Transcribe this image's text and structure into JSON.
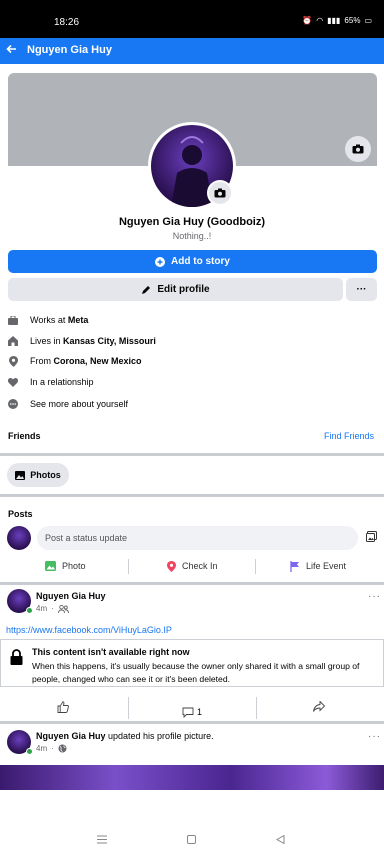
{
  "status_bar": {
    "time": "18:26",
    "battery": "65%"
  },
  "nav": {
    "title": "Nguyen Gia Huy"
  },
  "profile": {
    "name": "Nguyen Gia Huy (Goodboiz)",
    "bio": "Nothing..!",
    "add_story_label": "Add to story",
    "edit_profile_label": "Edit profile",
    "more_label": "···"
  },
  "about": {
    "work_prefix": "Works at ",
    "work_value": "Meta",
    "live_prefix": "Lives in ",
    "live_value": "Kansas City, Missouri",
    "from_prefix": "From ",
    "from_value": "Corona, New Mexico",
    "relationship": "In a relationship",
    "see_more": "See more about yourself"
  },
  "friends": {
    "label": "Friends",
    "find_label": "Find Friends"
  },
  "photos": {
    "label": "Photos"
  },
  "posts": {
    "label": "Posts",
    "status_placeholder": "Post a status update",
    "actions": {
      "photo": "Photo",
      "checkin": "Check In",
      "life_event": "Life Event"
    }
  },
  "post1": {
    "author": "Nguyen Gia Huy",
    "time": "4m",
    "dots": "···",
    "link": "https://www.facebook.com/ViHuyLaGio.IP",
    "notice_title": "This content isn't available right now",
    "notice_body": "When this happens, it's usually because the owner only shared it with a small group of people, changed who can see it or it's been deleted.",
    "comment_count": "1"
  },
  "post2": {
    "author": "Nguyen Gia Huy",
    "action_text": " updated his profile picture.",
    "time": "4m",
    "dots": "···"
  },
  "colors": {
    "accent": "#1877f2",
    "online": "#31a24c"
  }
}
